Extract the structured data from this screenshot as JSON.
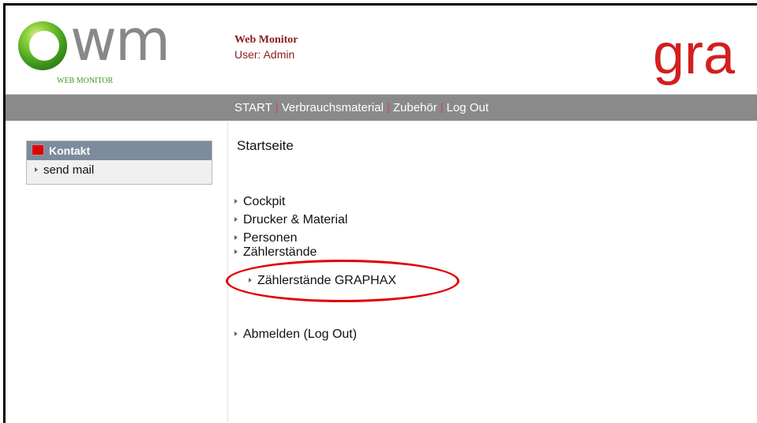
{
  "header": {
    "logo_text": "wm",
    "logo_subtitle": "WEB MONITOR",
    "app_title": "Web Monitor",
    "user_line": "User: Admin",
    "brand": "gra"
  },
  "nav": {
    "items": [
      "START",
      "Verbrauchsmaterial",
      "Zubehör",
      "Log Out"
    ]
  },
  "sidebar": {
    "header": "Kontakt",
    "items": [
      "send mail"
    ]
  },
  "main": {
    "title": "Startseite",
    "menu": [
      "Cockpit",
      "Drucker & Material",
      "Personen",
      "Zählerstände",
      "Zählerstände GRAPHAX",
      "Abmelden (Log Out)"
    ]
  },
  "colors": {
    "nav_bg": "#8a8a8a",
    "brand_red": "#d21f1f",
    "highlight_ellipse": "#e00000",
    "title_red": "#8b1a1a"
  }
}
